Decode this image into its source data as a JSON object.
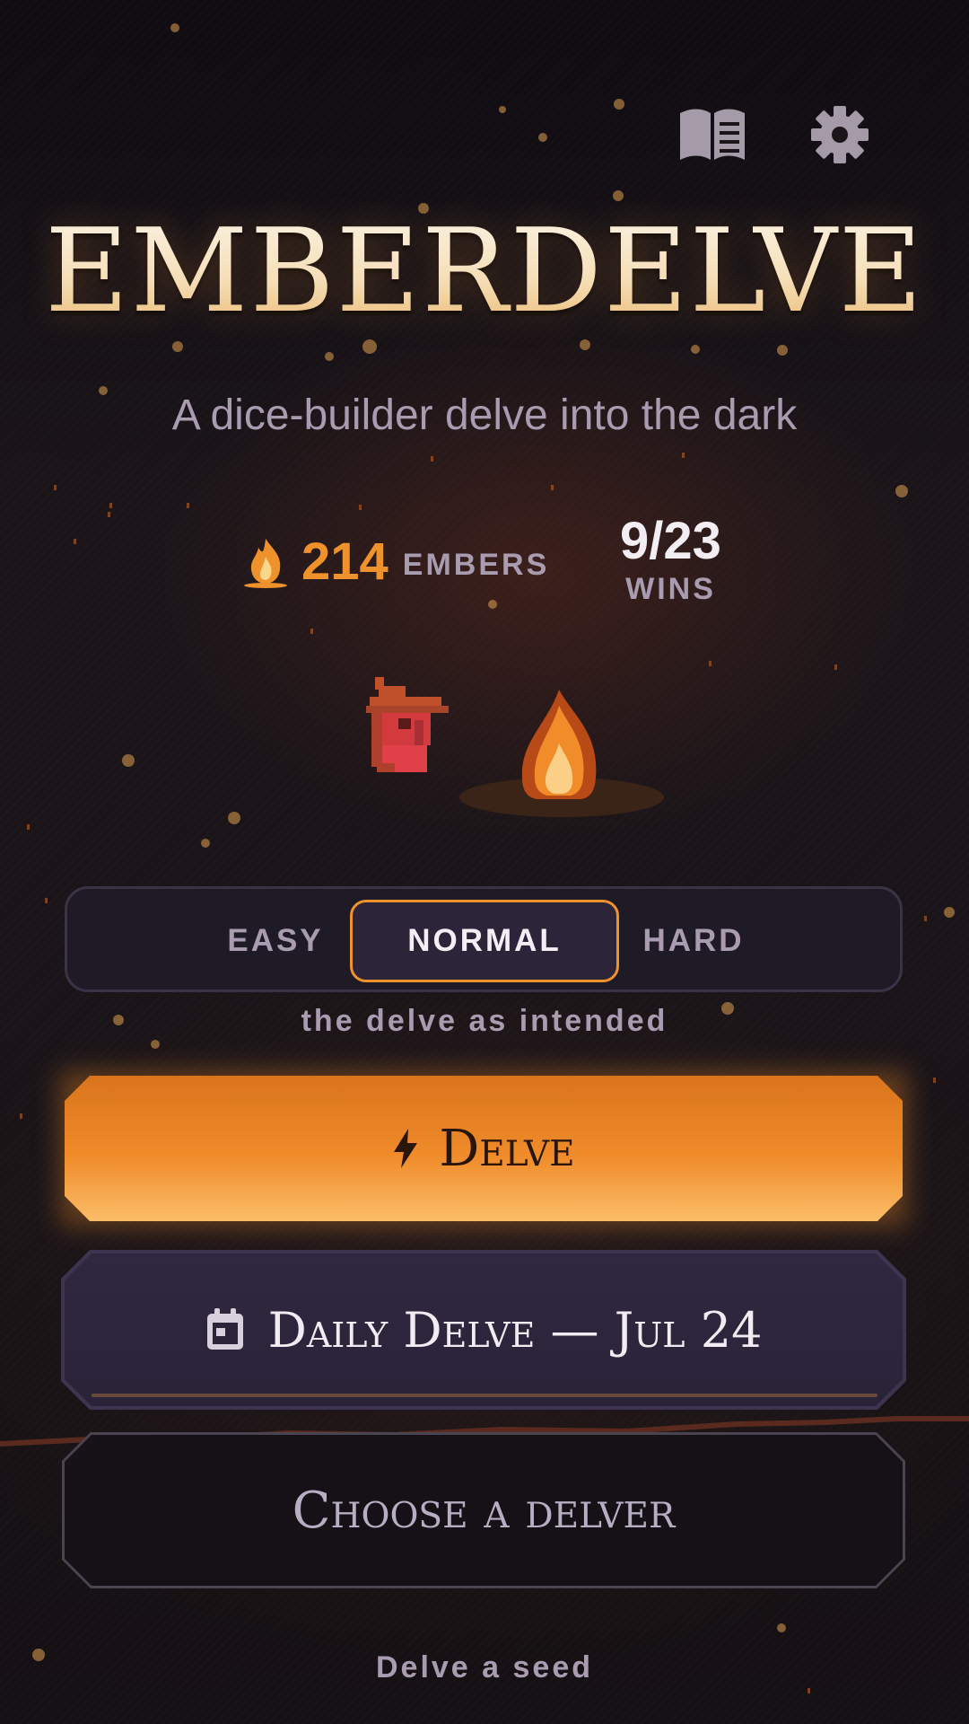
{
  "app": {
    "title": "EMBERDELVE",
    "subtitle": "A dice-builder delve into the dark"
  },
  "header": {
    "codex_icon": "open-book-icon",
    "settings_icon": "gear-icon"
  },
  "stats": {
    "embers_count": "214",
    "embers_label": "EMBERS",
    "embers_icon": "flame-icon",
    "wins_count": "9/23",
    "wins_label": "WINS"
  },
  "difficulty": {
    "options": [
      {
        "label": "EASY",
        "selected": false
      },
      {
        "label": "NORMAL",
        "selected": true
      },
      {
        "label": "HARD",
        "selected": false
      }
    ],
    "description": "the delve as intended"
  },
  "actions": {
    "delve_label": "Delve",
    "delve_icon": "lightning-bolt-icon",
    "daily_label": "Daily Delve — Jul 24",
    "daily_icon": "calendar-icon",
    "choose_label": "Choose a delver",
    "seed_label": "Delve a seed"
  },
  "colors": {
    "accent": "#f0922c",
    "background": "#141016",
    "muted_text": "#a99cb0",
    "panel": "#1e1a26"
  }
}
